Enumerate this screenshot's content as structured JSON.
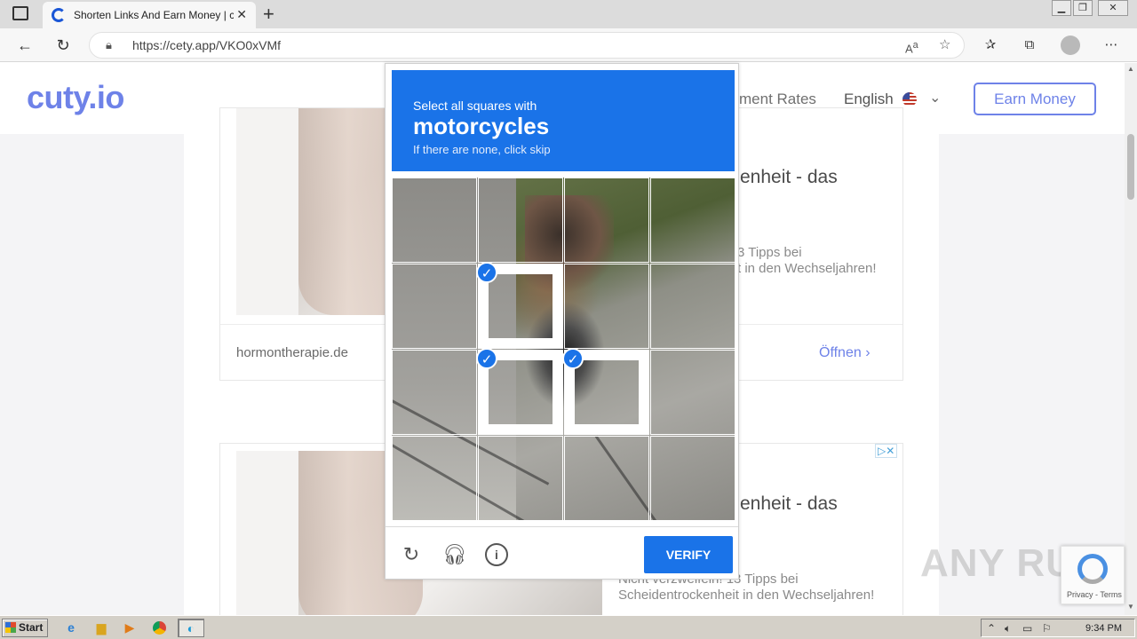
{
  "browser": {
    "tab_title": "Shorten Links And Earn Money | c",
    "url": "https://cety.app/VKO0xVMf",
    "tab_close": "✕",
    "new_tab": "+"
  },
  "site": {
    "logo": "cuty.io",
    "nav_rates": "ment Rates",
    "language": "English",
    "earn_button": "Earn Money"
  },
  "ads": [
    {
      "title": "enheit - das",
      "subtitle_line1": "3 Tipps bei",
      "subtitle_line2": "t in den Wechseljahren!",
      "domain": "hormontherapie.de",
      "open": "Öffnen"
    },
    {
      "title": "enheit - das",
      "subtitle_line1": "Nicht verzweifeln! 13 Tipps bei",
      "subtitle_line2": "Scheidentrockenheit in den Wechseljahren!"
    }
  ],
  "captcha": {
    "instruction": "Select all squares with",
    "object": "motorcycles",
    "hint": "If there are none, click skip",
    "selected_tiles": [
      5,
      9,
      10
    ],
    "verify": "VERIFY",
    "check_mark": "✓"
  },
  "recaptcha_badge": {
    "links": "Privacy - Terms"
  },
  "watermark": "ANY RUN",
  "taskbar": {
    "start": "Start",
    "clock": "9:34 PM"
  },
  "colors": {
    "captcha_blue": "#1a73e8",
    "brand": "#6e82e8"
  }
}
